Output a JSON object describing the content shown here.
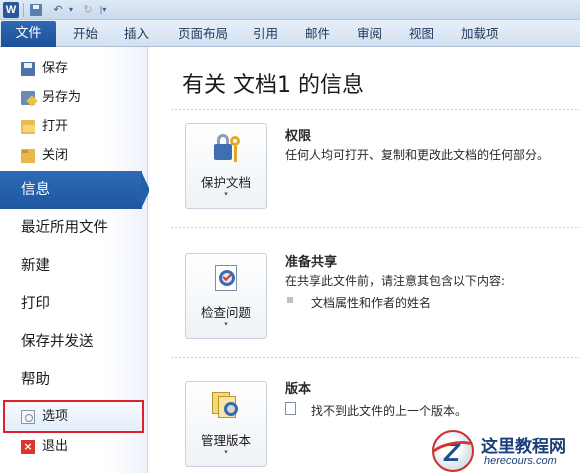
{
  "app": {
    "logo_letter": "W"
  },
  "quick_access": {
    "undo_dropdown_glyph": "▾",
    "more_glyph": "|▾"
  },
  "tabs": [
    {
      "label": "文件",
      "active": true
    },
    {
      "label": "开始"
    },
    {
      "label": "插入"
    },
    {
      "label": "页面布局"
    },
    {
      "label": "引用"
    },
    {
      "label": "邮件"
    },
    {
      "label": "审阅"
    },
    {
      "label": "视图"
    },
    {
      "label": "加载项"
    }
  ],
  "nav": {
    "small_top": [
      {
        "label": "保存",
        "icon": "save-icon"
      },
      {
        "label": "另存为",
        "icon": "save-as-icon"
      },
      {
        "label": "打开",
        "icon": "open-folder-icon"
      },
      {
        "label": "关闭",
        "icon": "close-folder-icon"
      }
    ],
    "big": [
      {
        "label": "信息",
        "active": true
      },
      {
        "label": "最近所用文件"
      },
      {
        "label": "新建"
      },
      {
        "label": "打印"
      },
      {
        "label": "保存并发送"
      },
      {
        "label": "帮助"
      }
    ],
    "small_bottom": [
      {
        "label": "选项",
        "icon": "options-icon",
        "highlighted": true
      },
      {
        "label": "退出",
        "icon": "exit-icon"
      }
    ],
    "exit_glyph": "×"
  },
  "main": {
    "title": "有关 文档1 的信息",
    "sections": [
      {
        "button_label": "保护文档",
        "button_icon": "lock-key-icon",
        "heading": "权限",
        "description": "任何人均可打开、复制和更改此文档的任何部分。"
      },
      {
        "button_label": "检查问题",
        "button_icon": "inspect-document-icon",
        "heading": "准备共享",
        "description": "在共享此文件前，请注意其包含以下内容:",
        "bullets": [
          "文档属性和作者的姓名"
        ]
      },
      {
        "button_label": "管理版本",
        "button_icon": "manage-versions-icon",
        "heading": "版本",
        "description": "找不到此文件的上一个版本。"
      }
    ],
    "caret_glyph": "▾"
  },
  "watermark": {
    "letter": "Z",
    "name": "这里教程网",
    "url": "herecours.com"
  },
  "colors": {
    "accent": "#2260aa",
    "highlight_border": "#e0202a"
  }
}
